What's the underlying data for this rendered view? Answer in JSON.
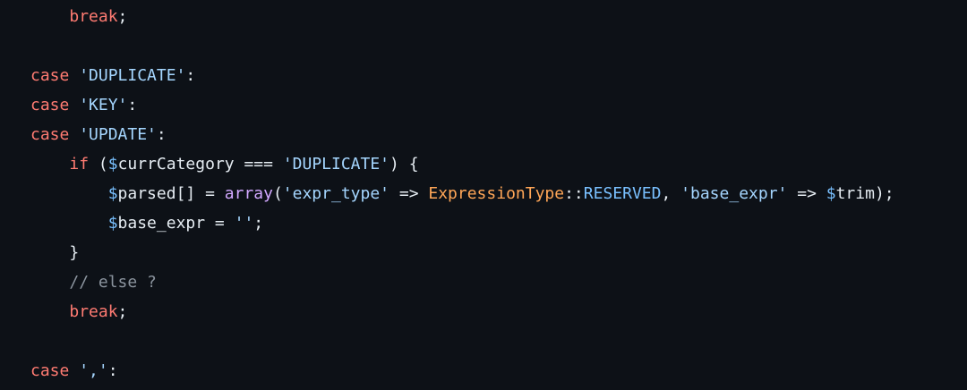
{
  "code": {
    "line1": {
      "indent": "    ",
      "kw": "break",
      "semi": ";"
    },
    "line3": {
      "kw": "case",
      "space": " ",
      "str": "'DUPLICATE'",
      "colon": ":"
    },
    "line4": {
      "kw": "case",
      "space": " ",
      "str": "'KEY'",
      "colon": ":"
    },
    "line5": {
      "kw": "case",
      "space": " ",
      "str": "'UPDATE'",
      "colon": ":"
    },
    "line6": {
      "indent": "    ",
      "kw": "if",
      "open": " (",
      "dollar": "$",
      "var": "currCategory",
      "op": " === ",
      "str": "'DUPLICATE'",
      "close": ") {"
    },
    "line7": {
      "indent": "        ",
      "dollar": "$",
      "var": "parsed",
      "p1": "[] = ",
      "func": "array",
      "p2": "(",
      "str1": "'expr_type'",
      "arrow1": " => ",
      "type": "ExpressionType",
      "scope": "::",
      "const": "RESERVED",
      "comma": ", ",
      "str2": "'base_expr'",
      "arrow2": " => ",
      "dollar2": "$",
      "var2": "trim",
      "end": ");"
    },
    "line8": {
      "indent": "        ",
      "dollar": "$",
      "var": "base_expr",
      "op": " = ",
      "str": "''",
      "semi": ";"
    },
    "line9": {
      "indent": "    ",
      "brace": "}"
    },
    "line10": {
      "indent": "    ",
      "comment": "// else ?"
    },
    "line11": {
      "indent": "    ",
      "kw": "break",
      "semi": ";"
    },
    "line13": {
      "kw": "case",
      "space": " ",
      "str": "','",
      "colon": ":"
    }
  }
}
